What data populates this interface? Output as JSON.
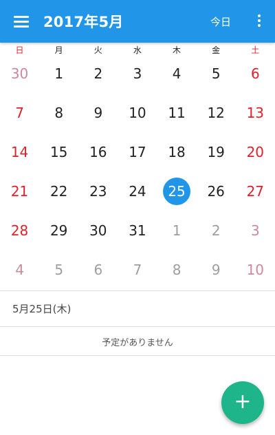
{
  "appbar": {
    "title": "2017年5月",
    "today_label": "今日",
    "menu_icon": "hamburger-menu-icon",
    "more_icon": "more-vert-icon",
    "background_color": "#2196e8"
  },
  "weekdays": [
    "日",
    "月",
    "火",
    "水",
    "木",
    "金",
    "土"
  ],
  "weeks": [
    [
      "30",
      "1",
      "2",
      "3",
      "4",
      "5",
      "6"
    ],
    [
      "7",
      "8",
      "9",
      "10",
      "11",
      "12",
      "13"
    ],
    [
      "14",
      "15",
      "16",
      "17",
      "18",
      "19",
      "20"
    ],
    [
      "21",
      "22",
      "23",
      "24",
      "25",
      "26",
      "27"
    ],
    [
      "28",
      "29",
      "30",
      "31",
      "1",
      "2",
      "3"
    ],
    [
      "4",
      "5",
      "6",
      "7",
      "8",
      "9",
      "10"
    ]
  ],
  "selected_day": "25",
  "colors": {
    "weekend": "#e0202a",
    "selected_circle": "#2196e8",
    "fab": "#1fb58a"
  },
  "selected_date_label": "5月25日(木)",
  "no_events_text": "予定がありません",
  "fab": {
    "label": "+",
    "icon": "add-icon"
  }
}
